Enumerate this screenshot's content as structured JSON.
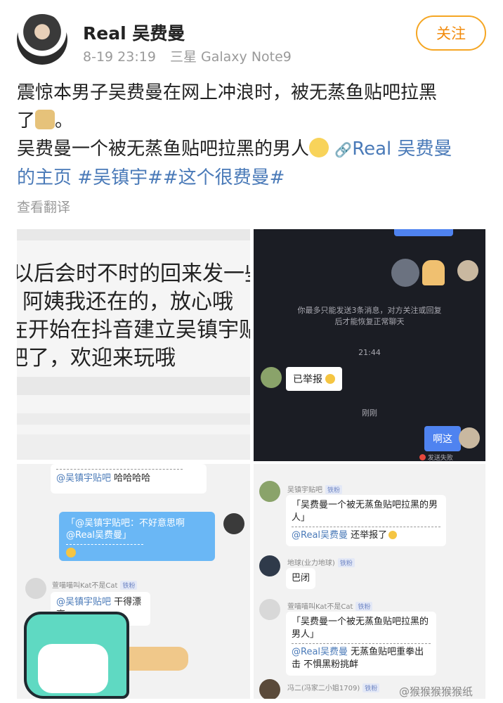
{
  "header": {
    "username": "Real 吴费曼",
    "time": "8-19 23:19",
    "device": "三星 Galaxy Note9",
    "follow_label": "关注"
  },
  "post": {
    "line1": "震惊本男子吴费曼在网上冲浪时，被无蒸鱼贴吧拉黑",
    "line2_prefix": "了",
    "line2_suffix": "。",
    "line3": "吴费曼一个被无蒸鱼贴吧拉黑的男人",
    "link_text": "Real 吴费曼",
    "line4_link": "的主页",
    "hashtag1": "#吴镇宇#",
    "hashtag2": "#这个很费曼#"
  },
  "translate_label": "查看翻译",
  "panel1": {
    "lines": [
      "以后会时不时的回来发一些",
      "阿姨我还在的，放心哦",
      "在开始在抖音建立吴镇宇贴",
      "吧了，欢迎来玩哦"
    ]
  },
  "panel2": {
    "notice_line1": "你最多只能发送3条消息，对方关注或回复",
    "notice_line2": "后才能恢复正常聊天",
    "time": "21:44",
    "reported": "已举报",
    "just_now": "刚刚",
    "sent_msg": "啊这",
    "send_failed": "发送失败"
  },
  "panel3": {
    "top_mention": "@吴镇宇贴吧",
    "top_text": "哈哈哈哈",
    "blue_quote": "「@吴镇宇贴吧：不好意思啊",
    "blue_quote2": "@Real吴费曼」",
    "user2_name": "萱喵喵叫Kat不是Cat",
    "user2_tag": "铁粉",
    "user2_mention": "@吴镇宇贴吧",
    "user2_text": "干得漂亮"
  },
  "panel4": {
    "user1_name": "吴镇宇贴吧",
    "user1_tag": "铁粉",
    "user1_quote": "「吴费曼一个被无蒸鱼贴吧拉黑的男人」",
    "user1_mention": "@Real吴费曼",
    "user1_text": "还举报了",
    "user2_name": "地球(业力地球)",
    "user2_tag": "铁粉",
    "user2_text": "巴闭",
    "user3_name": "萱喵喵叫Kat不是Cat",
    "user3_tag": "铁粉",
    "user3_quote": "「吴费曼一个被无蒸鱼贴吧拉黑的男人」",
    "user3_mention": "@Real吴费曼",
    "user3_text": "无蒸鱼贴吧重拳出击 不惧黑粉挑衅",
    "user4_name": "冯二(冯家二小姐1709)",
    "user4_tag": "铁粉"
  },
  "watermark": "@猴猴猴猴猴纸"
}
